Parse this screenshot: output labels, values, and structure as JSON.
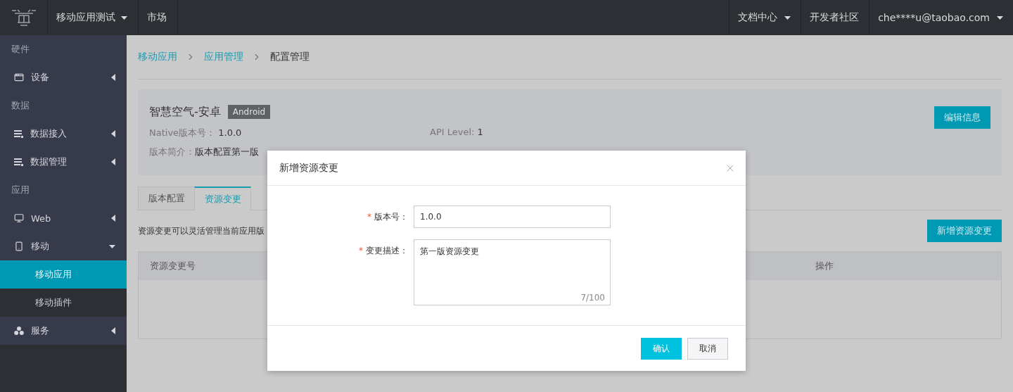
{
  "topbar": {
    "nav": [
      {
        "label": "移动应用测试",
        "dropdown": true
      },
      {
        "label": "市场",
        "dropdown": false
      }
    ],
    "right": [
      {
        "label": "文档中心",
        "dropdown": true
      },
      {
        "label": "开发者社区",
        "dropdown": false
      },
      {
        "label": "che****u@taobao.com",
        "dropdown": true
      }
    ]
  },
  "sidebar": {
    "sections": [
      {
        "title": "硬件",
        "items": [
          {
            "label": "设备",
            "kind": "device",
            "expanded": false,
            "selected": false
          }
        ]
      },
      {
        "title": "数据",
        "items": [
          {
            "label": "数据接入",
            "kind": "data",
            "expanded": false,
            "selected": false
          },
          {
            "label": "数据管理",
            "kind": "data",
            "expanded": false,
            "selected": false
          }
        ]
      },
      {
        "title": "应用",
        "items": [
          {
            "label": "Web",
            "kind": "web",
            "expanded": false,
            "selected": false
          },
          {
            "label": "移动",
            "kind": "mobile",
            "expanded": true,
            "selected": false,
            "children": [
              {
                "label": "移动应用",
                "selected": true
              },
              {
                "label": "移动插件",
                "selected": false
              }
            ]
          },
          {
            "label": "服务",
            "kind": "service",
            "expanded": false,
            "selected": false
          }
        ]
      }
    ]
  },
  "breadcrumb": [
    "移动应用",
    "应用管理",
    "配置管理"
  ],
  "app_info": {
    "name": "智慧空气-安卓",
    "platform": "Android",
    "edit_button": "编辑信息",
    "fields": [
      {
        "label": "Native版本号：",
        "value": "1.0.0"
      },
      {
        "label": "API Level:",
        "value": "1"
      },
      {
        "label": "版本简介：",
        "value": "版本配置第一版"
      }
    ]
  },
  "tabs": [
    {
      "label": "版本配置",
      "selected": false
    },
    {
      "label": "资源变更",
      "selected": true
    }
  ],
  "description": "资源变更可以灵活管理当前应用版",
  "add_button": "新增资源变更",
  "table": {
    "columns": [
      "资源变更号",
      "操作"
    ]
  },
  "dialog": {
    "title": "新增资源变更",
    "fields": [
      {
        "kind": "input",
        "label": "版本号：",
        "required_mark": "*",
        "value": "1.0.0"
      },
      {
        "kind": "textarea",
        "label": "变更描述：",
        "required_mark": "*",
        "value": "第一版资源变更",
        "counter": "7/100"
      }
    ],
    "buttons": [
      {
        "label": "确认",
        "primary": true
      },
      {
        "label": "取消",
        "primary": false
      }
    ]
  }
}
